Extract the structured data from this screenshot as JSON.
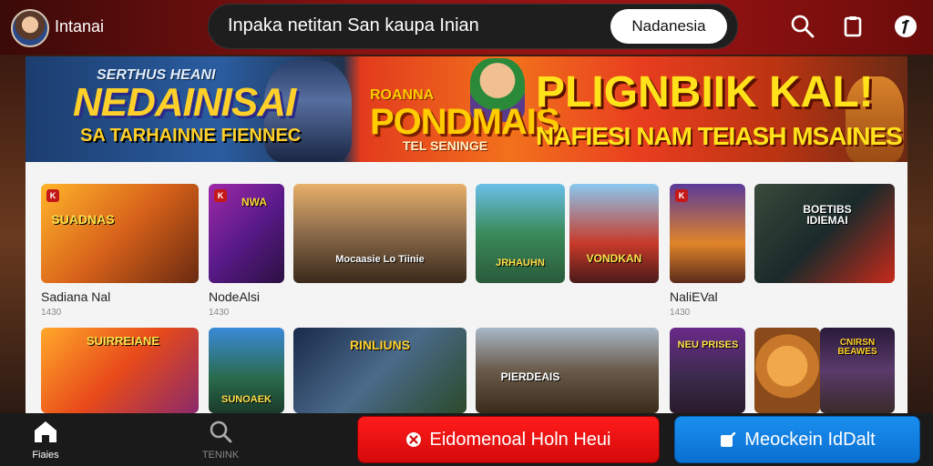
{
  "header": {
    "app_title": "Intanai",
    "search_text": "Inpaka netitan San kaupa Inian",
    "region_label": "Nadanesia",
    "icons": [
      "search-icon",
      "clipboard-icon",
      "info-icon"
    ]
  },
  "banner": {
    "left_subtitle": "SERTHUS HEANI",
    "left_title": "NEDAINISAI",
    "left_tagline": "SA TARHAINNE FIENNEC",
    "center_top": "ROANNA",
    "center_title": "PONDMAIS",
    "center_sub": "TEL SENINGE",
    "right_title": "PLIGNBIIK KAL!",
    "right_sub": "NAFIESI NAM TEIASH MSAINES"
  },
  "games_row1": [
    {
      "art_title": "SUADNAS",
      "caption": "Sadiana Nal",
      "meta": "1430"
    },
    {
      "art_title": "NWA",
      "caption": "NodeAlsi",
      "meta": "1430"
    },
    {
      "art_title": "Mocaasie Lo Tiinie",
      "caption": "",
      "meta": ""
    },
    {
      "art_title": "JRHAUHN",
      "caption": "",
      "meta": ""
    },
    {
      "art_title": "VONDKAN",
      "caption": "",
      "meta": ""
    },
    {
      "art_title": "",
      "caption": "NaliEVal",
      "meta": "1430"
    },
    {
      "art_title": "BOETIBS IDIEMAI",
      "caption": "",
      "meta": ""
    }
  ],
  "games_row2": [
    {
      "art_title": "SUIRREIANE"
    },
    {
      "art_title": "SUNOAEK"
    },
    {
      "art_title": "RINLIUNS"
    },
    {
      "art_title": "PIERDEAIS"
    },
    {
      "art_title": "NEU PRISES"
    },
    {
      "art_title": ""
    },
    {
      "art_title": "CNIRSN BEAWES"
    }
  ],
  "bottom_nav": {
    "home_label": "Fiaies",
    "search_label": "TENINK",
    "primary_action": "Eidomenoal Holn Heui",
    "secondary_action": "Meockein IdDalt"
  },
  "colors": {
    "primary_red": "#e01010",
    "secondary_blue": "#1a85e8",
    "topbar_red": "#8a1212"
  }
}
